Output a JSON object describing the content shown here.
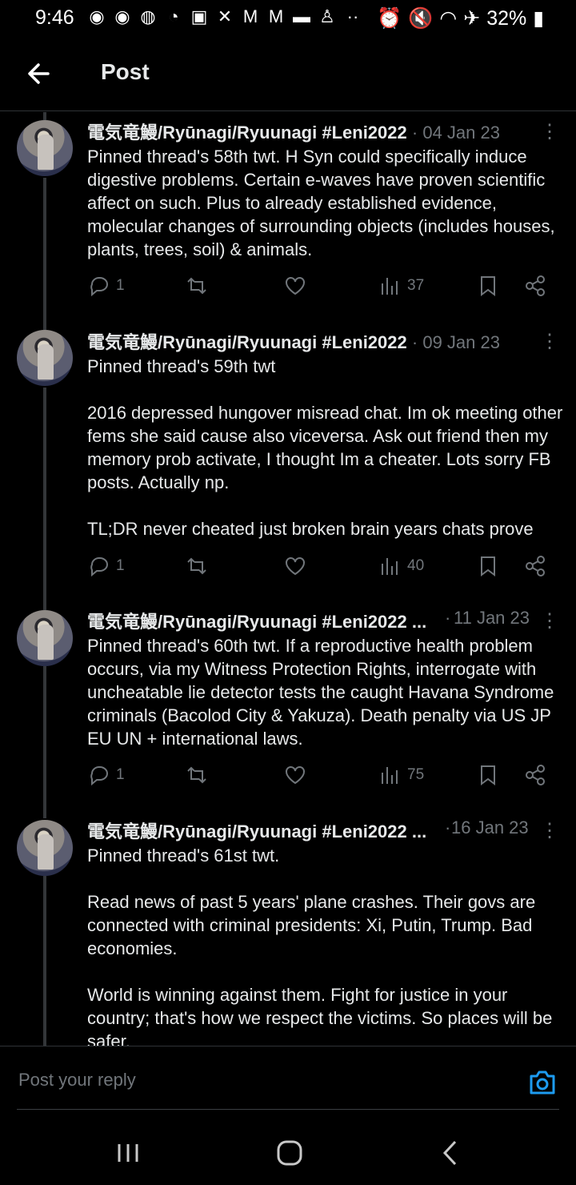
{
  "status_bar": {
    "time": "9:46",
    "battery": "32%",
    "notification_icons": [
      "messenger-icon",
      "messenger-icon",
      "account-circle-icon",
      "reddit-icon",
      "twitch-icon",
      "x-icon",
      "gmail-icon",
      "gmail-icon",
      "chat-icon",
      "person-icon"
    ],
    "more": "··"
  },
  "header": {
    "title": "Post"
  },
  "posts": [
    {
      "name": "電気竜鰻/Ryūnagi/Ryuunagi #Leni2022",
      "dot": "·",
      "date": "04 Jan 23",
      "text": "Pinned thread's 58th twt. H Syn could specifically induce digestive problems. Certain e-waves have proven scientific affect on such. Plus to already established evidence, molecular changes of surrounding objects (includes houses, plants, trees, soil) & animals.",
      "replies": "1",
      "views": "37"
    },
    {
      "name": "電気竜鰻/Ryūnagi/Ryuunagi #Leni2022",
      "dot": "·",
      "date": "09 Jan 23",
      "text": "Pinned thread's 59th twt\n\n2016 depressed hungover misread chat. Im ok meeting other fems she said cause also viceversa. Ask out friend then my memory prob activate, I thought Im a cheater. Lots sorry FB posts. Actually np.\n\nTL;DR never cheated just broken brain years chats prove",
      "replies": "1",
      "views": "40"
    },
    {
      "name": "電気竜鰻/Ryūnagi/Ryuunagi #Leni2022 ...",
      "dot": "·",
      "date": "11 Jan 23",
      "text": "Pinned thread's 60th twt. If a reproductive health problem occurs, via my Witness Protection Rights, interrogate with uncheatable lie detector tests the caught Havana Syndrome criminals (Bacolod City & Yakuza). Death penalty via US JP EU UN + international laws.",
      "replies": "1",
      "views": "75"
    },
    {
      "name": "電気竜鰻/Ryūnagi/Ryuunagi #Leni2022 ...",
      "dot": "·",
      "date": "16 Jan 23",
      "text": "Pinned thread's 61st twt.\n\nRead news of past 5 years' plane crashes. Their govs are connected with criminal presidents: Xi, Putin, Trump. Bad economies.\n\nWorld is winning against them. Fight for justice in your country; that's how we respect the victims. So places will be safer."
    }
  ],
  "reply_box": {
    "placeholder": "Post your reply"
  },
  "nav": [
    "recents-icon",
    "home-icon",
    "back-icon"
  ]
}
